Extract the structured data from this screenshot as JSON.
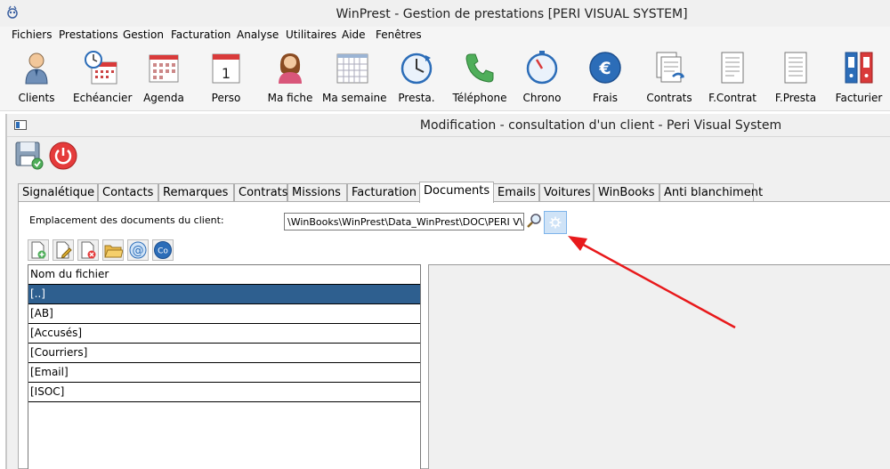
{
  "window": {
    "title": "WinPrest - Gestion de prestations [PERI VISUAL SYSTEM]"
  },
  "menu": [
    "Fichiers",
    "Prestations",
    "Gestion",
    "Facturation",
    "Analyse",
    "Utilitaires",
    "Aide",
    "Fenêtres"
  ],
  "toolbar": [
    "Clients",
    "Echéancier",
    "Agenda",
    "Perso",
    "Ma fiche",
    "Ma semaine",
    "Presta.",
    "Téléphone",
    "Chrono",
    "Frais",
    "Contrats",
    "F.Contrat",
    "F.Presta",
    "Facturier"
  ],
  "perso_day": "1",
  "child": {
    "title": "Modification - consultation d'un client  - Peri Visual System"
  },
  "tabs": [
    "Signalétique",
    "Contacts",
    "Remarques",
    "Contrats",
    "Missions",
    "Facturation",
    "Documents",
    "Emails",
    "Voitures",
    "WinBooks",
    "Anti blanchiment"
  ],
  "documents": {
    "location_label": "Emplacement des documents du client:",
    "location_value": "\\WinBooks\\WinPrest\\Data_WinPrest\\DOC\\PERI V\\",
    "column_header": "Nom du fichier",
    "files": [
      "[..]",
      "[AB]",
      "[Accusés]",
      "[Courriers]",
      "[Email]",
      "[ISOC]"
    ],
    "co_label": "Co",
    "at_label": "@"
  },
  "colors": {
    "selected_row": "#2e5f8f",
    "annotation_arrow": "#e8191b",
    "accent": "#2c6db8"
  }
}
